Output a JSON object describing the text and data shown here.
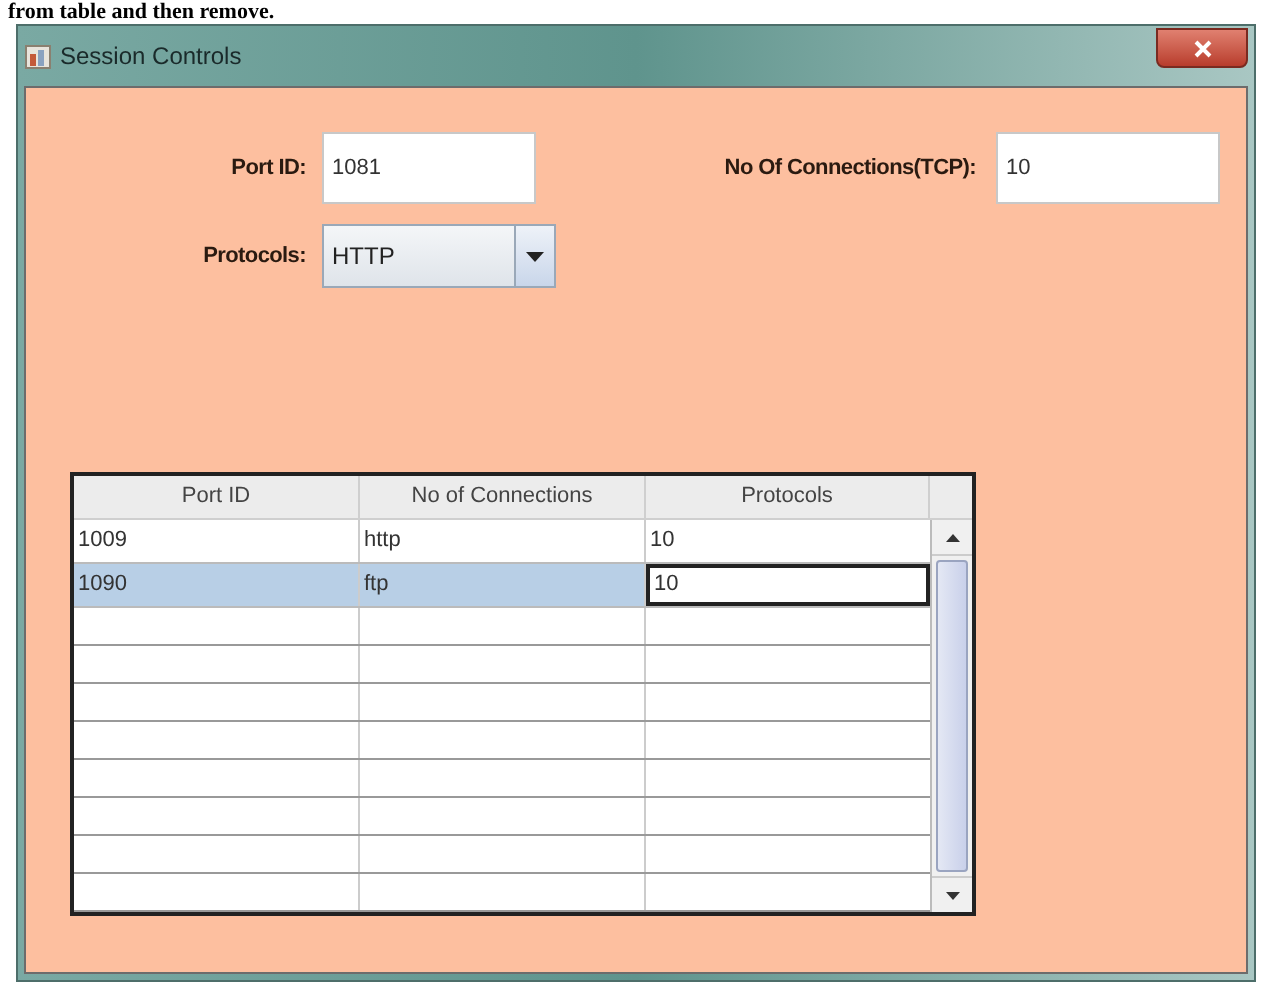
{
  "caption": "from table and then remove.",
  "window": {
    "title": "Session Controls"
  },
  "form": {
    "port_id": {
      "label": "Port ID:",
      "value": "1081"
    },
    "connections": {
      "label": "No Of Connections(TCP):",
      "value": "10"
    },
    "protocols": {
      "label": "Protocols:",
      "value": "HTTP"
    }
  },
  "table": {
    "columns": [
      "Port ID",
      "No of Connections",
      "Protocols"
    ],
    "rows": [
      {
        "selected": false,
        "cells": [
          {
            "text": "1009",
            "editing": false
          },
          {
            "text": "http",
            "editing": false
          },
          {
            "text": "10",
            "editing": false
          }
        ]
      },
      {
        "selected": true,
        "cells": [
          {
            "text": "1090",
            "editing": false
          },
          {
            "text": "ftp",
            "editing": false
          },
          {
            "text": "10",
            "editing": true
          }
        ]
      }
    ]
  }
}
